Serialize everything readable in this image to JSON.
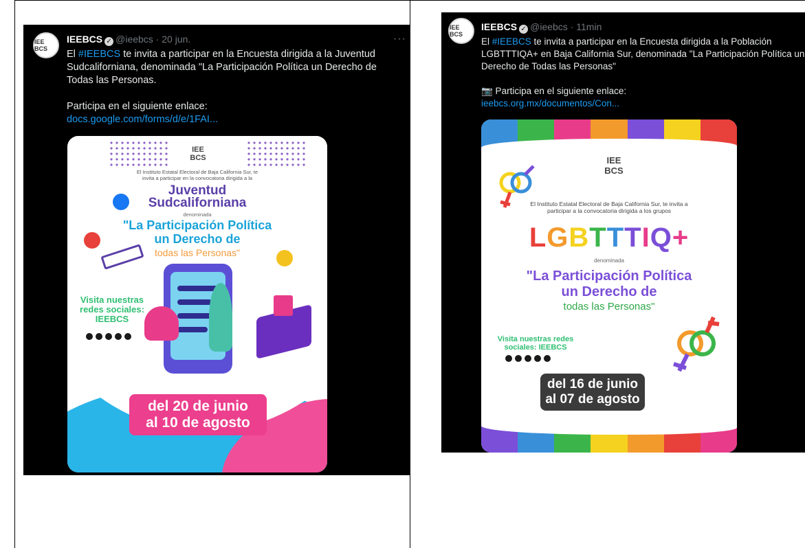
{
  "tweets": [
    {
      "avatar_text": "IEE BCS",
      "name": "IEEBCS",
      "handle": "@ieebcs",
      "time": "20 jun.",
      "more": "···",
      "text_before_tag": "El ",
      "hashtag": "#IEEBCS",
      "text_after_tag": " te invita a participar en la Encuesta dirigida a la Juventud Sudcaliforniana, denominada \"La Participación Política un Derecho de Todas las Personas.",
      "link_intro": "Participa en el siguiente enlace:",
      "link": "docs.google.com/forms/d/e/1FAI...",
      "poster": {
        "logo": "IEE BCS",
        "intro": "El Instituto Estatal Electoral de Baja California Sur, te invita a participar en la convocatoria dirigida a la",
        "title_line1": "Juventud",
        "title_line2": "Sudcaliforniana",
        "denominada": "denominada",
        "quote_line1": "\"La Participación Política",
        "quote_line2": "un Derecho de",
        "quote_line3": "todas las Personas\"",
        "visit": "Visita nuestras redes sociales: IEEBCS",
        "dates_line1": "del 20 de junio",
        "dates_line2": "al 10 de agosto",
        "colors": {
          "pink": "#ec3f8d",
          "blue": "#2ab5e8",
          "purple": "#5a3fa8",
          "green": "#2fbf71"
        }
      }
    },
    {
      "avatar_text": "IEE BCS",
      "name": "IEEBCS",
      "handle": "@ieebcs",
      "time": "11min",
      "text_before_tag": "El ",
      "hashtag": "#IEEBCS",
      "text_after_tag": " te invita a participar en la Encuesta dirigida a la Población LGBTTTIQA+ en Baja California Sur, denominada \"La Participación Política un Derecho de Todas las Personas\"",
      "link_intro": "📷 Participa en el siguiente enlace:",
      "link": "ieebcs.org.mx/documentos/Con...",
      "poster": {
        "logo": "IEE BCS",
        "intro": "El Instituto Estatal Electoral de Baja California Sur, te invita a participar a la convocatoria dirigida a los grupos",
        "group": "LGBTTTIQ+",
        "denominada": "denominada",
        "quote_line1": "\"La Participación Política",
        "quote_line2": "un Derecho de",
        "quote_line3": "todas las Personas\"",
        "visit": "Visita nuestras redes sociales: IEEBCS",
        "dates_line1": "del 16 de junio",
        "dates_line2": "al 07 de agosto",
        "colors": {
          "rainbow": [
            "#e8403a",
            "#f39a2c",
            "#f4d21f",
            "#3bb54a",
            "#3a8fd9",
            "#7b4fd8",
            "#e83c8a"
          ]
        }
      }
    }
  ]
}
